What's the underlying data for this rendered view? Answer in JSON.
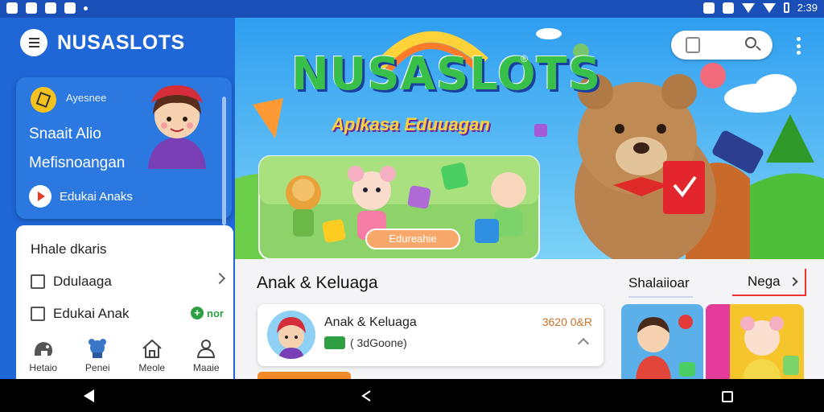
{
  "status_bar": {
    "time": "2:39"
  },
  "sidebar": {
    "app_title": "NUSASLOTS",
    "promo": {
      "small_label": "Ayesnee",
      "line1": "Snaait Alio",
      "line2": "Mefisnoangan",
      "cta": "Edukai Anaks"
    },
    "filter": {
      "title": "Hhale dkaris",
      "items": [
        {
          "label": "Ddulaaga"
        },
        {
          "label": "Edukai Anak",
          "badge": "nor"
        }
      ]
    },
    "tabs": [
      {
        "label": "Hetaio",
        "icon": "elephant-icon"
      },
      {
        "label": "Penei",
        "icon": "toy-icon"
      },
      {
        "label": "Meole",
        "icon": "home-icon"
      },
      {
        "label": "Maaie",
        "icon": "person-icon"
      }
    ]
  },
  "hero": {
    "logo": "NUSASLOTS",
    "registered": "®",
    "subtitle": "Aplkasa Eduuagan",
    "chip": "Edureahie"
  },
  "main": {
    "section_title": "Anak & Keluaga",
    "see_all": "Shalaiioar",
    "nega": "Nega",
    "app_card": {
      "name": "Anak & Keluaga",
      "meta": "( 3dGoone)",
      "price": "3620 0&R"
    }
  },
  "colors": {
    "brand_blue": "#1f66d6",
    "accent_green": "#2ea043",
    "accent_orange": "#c8742a",
    "highlight_red": "#e33333"
  }
}
